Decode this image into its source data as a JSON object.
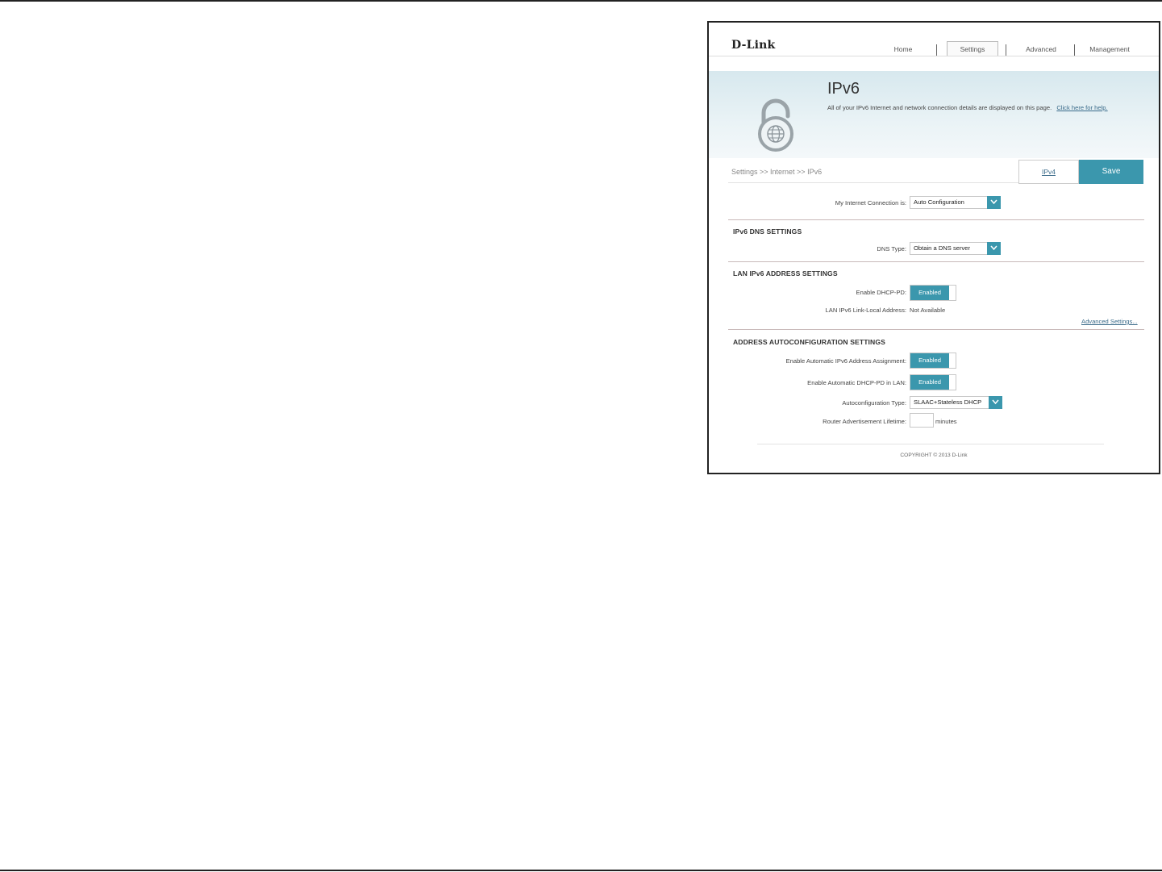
{
  "brand": {
    "logo_text": "D-Link"
  },
  "nav": {
    "home": "Home",
    "settings": "Settings",
    "advanced": "Advanced",
    "management": "Management",
    "active": "Settings"
  },
  "header": {
    "title": "IPv6",
    "description": "All of your IPv6 Internet and network connection details are displayed on this page.",
    "help_link": "Click here for help."
  },
  "breadcrumb": "Settings >> Internet >> IPv6",
  "actions": {
    "ipv4_label": "IPv4",
    "save_label": "Save"
  },
  "connection": {
    "label": "My Internet Connection is:",
    "value": "Auto Configuration"
  },
  "dns": {
    "section_title": "IPv6 DNS SETTINGS",
    "type_label": "DNS Type:",
    "type_value": "Obtain a DNS server"
  },
  "lan": {
    "section_title": "LAN IPv6 ADDRESS SETTINGS",
    "dhcp_pd_label": "Enable DHCP-PD:",
    "dhcp_pd_state": "Enabled",
    "link_local_label": "LAN IPv6 Link-Local Address:",
    "link_local_value": "Not Available",
    "advanced_link": "Advanced Settings..."
  },
  "autoconf": {
    "section_title": "ADDRESS AUTOCONFIGURATION SETTINGS",
    "auto_assign_label": "Enable Automatic IPv6 Address Assignment:",
    "auto_assign_state": "Enabled",
    "auto_dhcp_pd_label": "Enable Automatic DHCP-PD in LAN:",
    "auto_dhcp_pd_state": "Enabled",
    "type_label": "Autoconfiguration Type:",
    "type_value": "SLAAC+Stateless DHCP",
    "lifetime_label": "Router Advertisement Lifetime:",
    "lifetime_value": "",
    "lifetime_unit": "minutes"
  },
  "footer": {
    "copyright": "COPYRIGHT © 2013 D-Link"
  },
  "colors": {
    "accent": "#3b97ad",
    "banner": "#d7e8ee",
    "link": "#3a6b8a"
  }
}
